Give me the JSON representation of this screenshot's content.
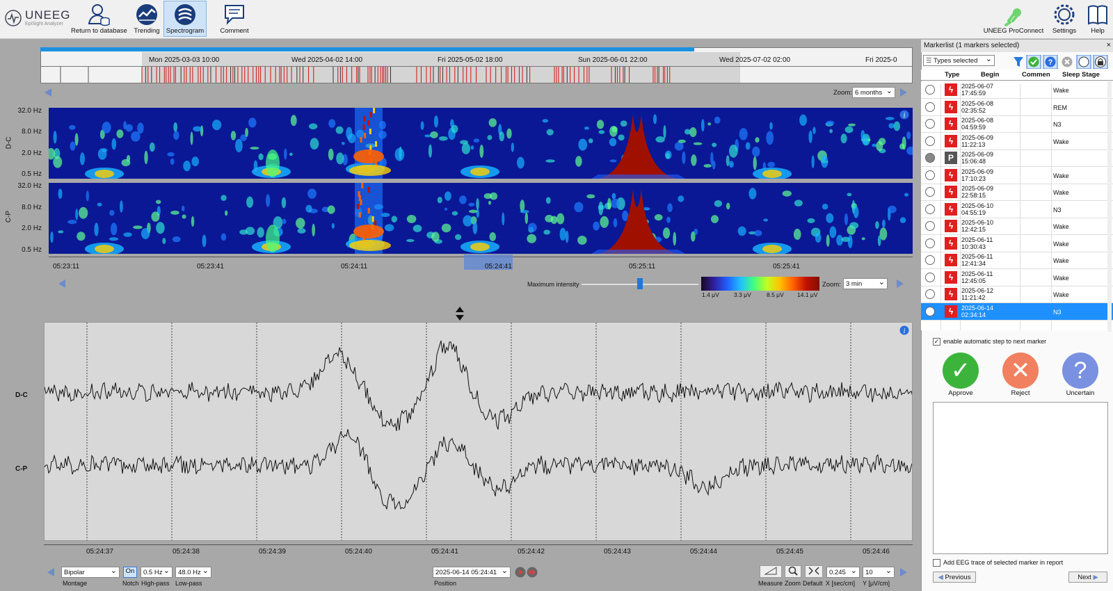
{
  "toolbar": {
    "logo_text": "UNEEG",
    "logo_sub": "EpiSight Analyzer",
    "return_label": "Return to database",
    "trending_label": "Trending",
    "spectrogram_label": "Spectrogram",
    "comment_label": "Comment",
    "proconnect_label": "UNEEG ProConnect",
    "settings_label": "Settings",
    "help_label": "Help"
  },
  "timeline": {
    "dates": [
      "Mon 2025-03-03 10:00",
      "Wed 2025-04-02 14:00",
      "Fri 2025-05-02 18:00",
      "Sun 2025-06-01 22:00",
      "Wed 2025-07-02 02:00",
      "Fri 2025-0"
    ],
    "zoom_label": "Zoom:",
    "zoom_value": "6 months"
  },
  "spectrogram": {
    "channels": [
      "D-C",
      "C-P"
    ],
    "freq_labels": [
      "32.0 Hz",
      "8.0 Hz",
      "2.0 Hz",
      "0.5 Hz"
    ],
    "time_labels": [
      "05:23:11",
      "05:23:41",
      "05:24:11",
      "05:24:41",
      "05:25:11",
      "05:25:41"
    ],
    "max_intensity_label": "Maximum intensity",
    "colorbar_ticks": [
      "1.4 μV",
      "3.3 μV",
      "8.5 μV",
      "14.1 μV"
    ],
    "zoom_label": "Zoom:",
    "zoom_value": "3 min"
  },
  "eeg": {
    "channels": [
      "D-C",
      "C-P"
    ],
    "time_labels": [
      "05:24:37",
      "05:24:38",
      "05:24:39",
      "05:24:40",
      "05:24:41",
      "05:24:42",
      "05:24:43",
      "05:24:44",
      "05:24:45",
      "05:24:46"
    ]
  },
  "controls": {
    "montage_value": "Bipolar",
    "montage_label": "Montage",
    "notch_value": "On",
    "notch_label": "Notch",
    "highpass_value": "0.5 Hz",
    "highpass_label": "High-pass",
    "lowpass_value": "48.0 Hz",
    "lowpass_label": "Low-pass",
    "position_value": "2025-06-14 05:24:41",
    "position_label": "Position",
    "measure_label": "Measure",
    "zoom_label": "Zoom",
    "default_label": "Default",
    "x_value": "0.245",
    "x_label": "X [sec/cm]",
    "y_value": "10",
    "y_label": "Y [μV/cm]"
  },
  "markerlist": {
    "title": "Markerlist (1 markers selected)",
    "filter_value": "Types selected",
    "columns": [
      "Type",
      "Begin",
      "Commen",
      "Sleep Stage"
    ],
    "rows": [
      {
        "date": "2025-06-07",
        "time": "17:45:59",
        "stage": "Wake",
        "type": "seizure"
      },
      {
        "date": "2025-06-08",
        "time": "02:35:52",
        "stage": "REM",
        "type": "seizure"
      },
      {
        "date": "2025-06-08",
        "time": "04:59:59",
        "stage": "N3",
        "type": "seizure"
      },
      {
        "date": "2025-06-09",
        "time": "11:22:13",
        "stage": "Wake",
        "type": "seizure"
      },
      {
        "date": "2025-06-09",
        "time": "15:06:48",
        "stage": "",
        "type": "patient"
      },
      {
        "date": "2025-06-09",
        "time": "17:10:23",
        "stage": "Wake",
        "type": "seizure"
      },
      {
        "date": "2025-06-09",
        "time": "22:58:15",
        "stage": "Wake",
        "type": "seizure"
      },
      {
        "date": "2025-06-10",
        "time": "04:55:19",
        "stage": "N3",
        "type": "seizure"
      },
      {
        "date": "2025-06-10",
        "time": "12:42:15",
        "stage": "Wake",
        "type": "seizure"
      },
      {
        "date": "2025-06-11",
        "time": "10:30:43",
        "stage": "Wake",
        "type": "seizure"
      },
      {
        "date": "2025-06-11",
        "time": "12:41:34",
        "stage": "Wake",
        "type": "seizure"
      },
      {
        "date": "2025-06-11",
        "time": "12:45:05",
        "stage": "Wake",
        "type": "seizure"
      },
      {
        "date": "2025-06-12",
        "time": "11:21:42",
        "stage": "Wake",
        "type": "seizure"
      },
      {
        "date": "2025-06-14",
        "time": "02:34:14",
        "stage": "N3",
        "type": "seizure"
      }
    ],
    "auto_step_label": "enable automatic step to next marker",
    "approve_label": "Approve",
    "reject_label": "Reject",
    "uncertain_label": "Uncertain",
    "add_eeg_label": "Add EEG trace of selected marker in report",
    "previous_label": "Previous",
    "next_label": "Next"
  },
  "colors": {
    "accent_blue": "#1e90e0",
    "marker_red": "#e02020",
    "approve_green": "#3cb43c",
    "reject_orange": "#f08060",
    "uncertain_blue": "#7a90e0",
    "spectro_bg": "#0a1896"
  }
}
